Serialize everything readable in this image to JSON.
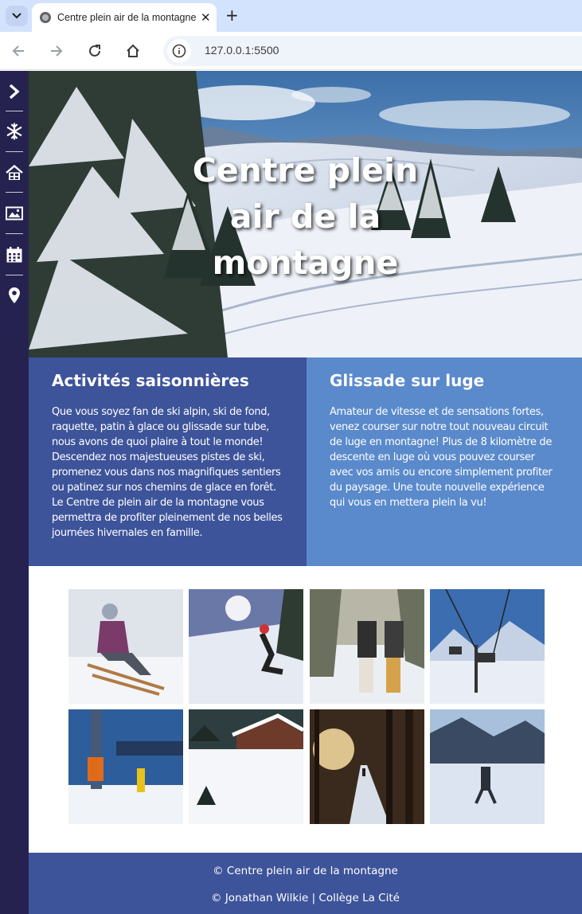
{
  "browser": {
    "tab_title": "Centre plein air de la montagne",
    "tab_close": "✕",
    "new_tab": "+",
    "url": "127.0.0.1:5500",
    "colors": {
      "tabstrip": "#d3e3fd",
      "toolbar": "#ffffff",
      "omnibox": "#eff3fa"
    }
  },
  "sidebar": {
    "items": [
      {
        "icon": "chevron-right-icon"
      },
      {
        "icon": "snowflake-icon"
      },
      {
        "icon": "house-icon"
      },
      {
        "icon": "image-icon"
      },
      {
        "icon": "calendar-icon"
      },
      {
        "icon": "map-pin-icon"
      }
    ],
    "color": "#252250"
  },
  "hero": {
    "title": "Centre plein air de la montagne"
  },
  "sections": [
    {
      "title": "Activités saisonnières",
      "text": "Que vous soyez fan de ski alpin, ski de fond, raquette, patin à glace ou glissade sur tube, nous avons de quoi plaire à tout le monde! Descendez nos majestueuses pistes de ski, promenez vous dans nos magnifiques sentiers ou patinez sur nos chemins de glace en forêt. Le Centre de plein air de la montagne vous permettra de profiter pleinement de nos belles journées hivernales en famille.",
      "color": "#3d539a"
    },
    {
      "title": "Glissade sur luge",
      "text": "Amateur de vitesse et de sensations fortes, venez courser sur notre tout nouveau circuit de luge en montagne! Plus de 8 kilomètre de descente en luge où vous pouvez courser avec vos amis ou encore simplement profiter du paysage. Une toute nouvelle expérience qui vous en mettera plein la vu!",
      "color": "#5a8acb"
    }
  ],
  "gallery": [
    "sled-child-photo",
    "skier-downhill-photo",
    "snowshoe-hikers-photo",
    "chairlift-photo",
    "ski-lift-station-photo",
    "chalet-snow-photo",
    "forest-path-sunset-photo",
    "frozen-lake-skater-photo"
  ],
  "footer": {
    "line1": "© Centre plein air de la montagne",
    "line2": "© Jonathan Wilkie | Collège La Cité",
    "color": "#3d539a"
  }
}
